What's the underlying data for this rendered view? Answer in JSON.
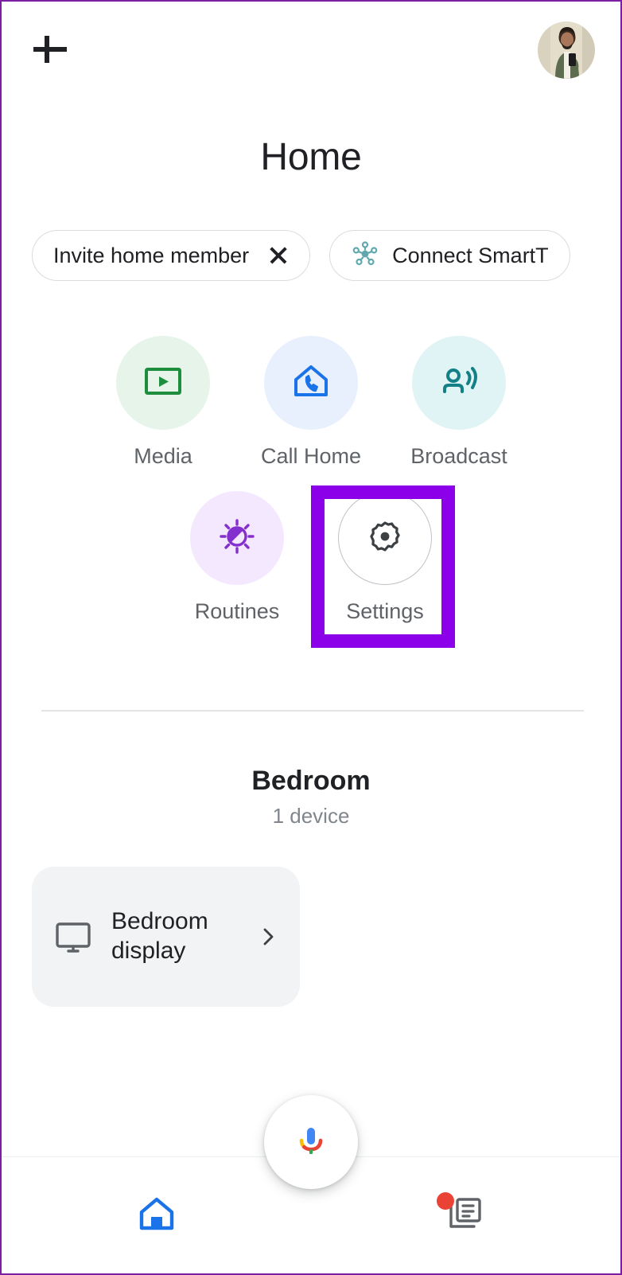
{
  "app": {
    "screen_title": "Home"
  },
  "topbar": {
    "add_icon": "plus-icon",
    "avatar_icon": "user-avatar"
  },
  "chips": [
    {
      "label": "Invite home member",
      "has_close": true,
      "icon": null
    },
    {
      "label": "Connect SmartT",
      "has_close": false,
      "icon": "smart-things-hub-icon"
    }
  ],
  "actions": {
    "row1": [
      {
        "label": "Media",
        "icon": "media-play-icon",
        "circle_color": "#e6f4ea",
        "icon_color": "#1e8e3e"
      },
      {
        "label": "Call Home",
        "icon": "call-home-icon",
        "circle_color": "#e8f0fe",
        "icon_color": "#1a73e8"
      },
      {
        "label": "Broadcast",
        "icon": "broadcast-icon",
        "circle_color": "#e0f3f5",
        "icon_color": "#128086"
      }
    ],
    "row2": [
      {
        "label": "Routines",
        "icon": "routines-sun-icon",
        "circle_color": "#f3e8fd",
        "icon_color": "#8430ce"
      },
      {
        "label": "Settings",
        "icon": "settings-gear-icon",
        "circle_color": "#ffffff",
        "icon_color": "#3c4043"
      }
    ]
  },
  "highlight": {
    "target": "Settings",
    "color": "#8b00e8"
  },
  "room": {
    "name": "Bedroom",
    "device_count_label": "1 device",
    "devices": [
      {
        "name": "Bedroom display",
        "icon": "display-monitor-icon",
        "chevron": "chevron-right-icon"
      }
    ]
  },
  "assistant": {
    "fab_icon": "google-assistant-mic-icon"
  },
  "bottom_nav": {
    "items": [
      {
        "name": "home",
        "icon": "home-icon",
        "active": true,
        "badge": false,
        "color": "#1a73e8"
      },
      {
        "name": "feed",
        "icon": "feed-icon",
        "active": false,
        "badge": true,
        "color": "#5f6368"
      }
    ]
  }
}
